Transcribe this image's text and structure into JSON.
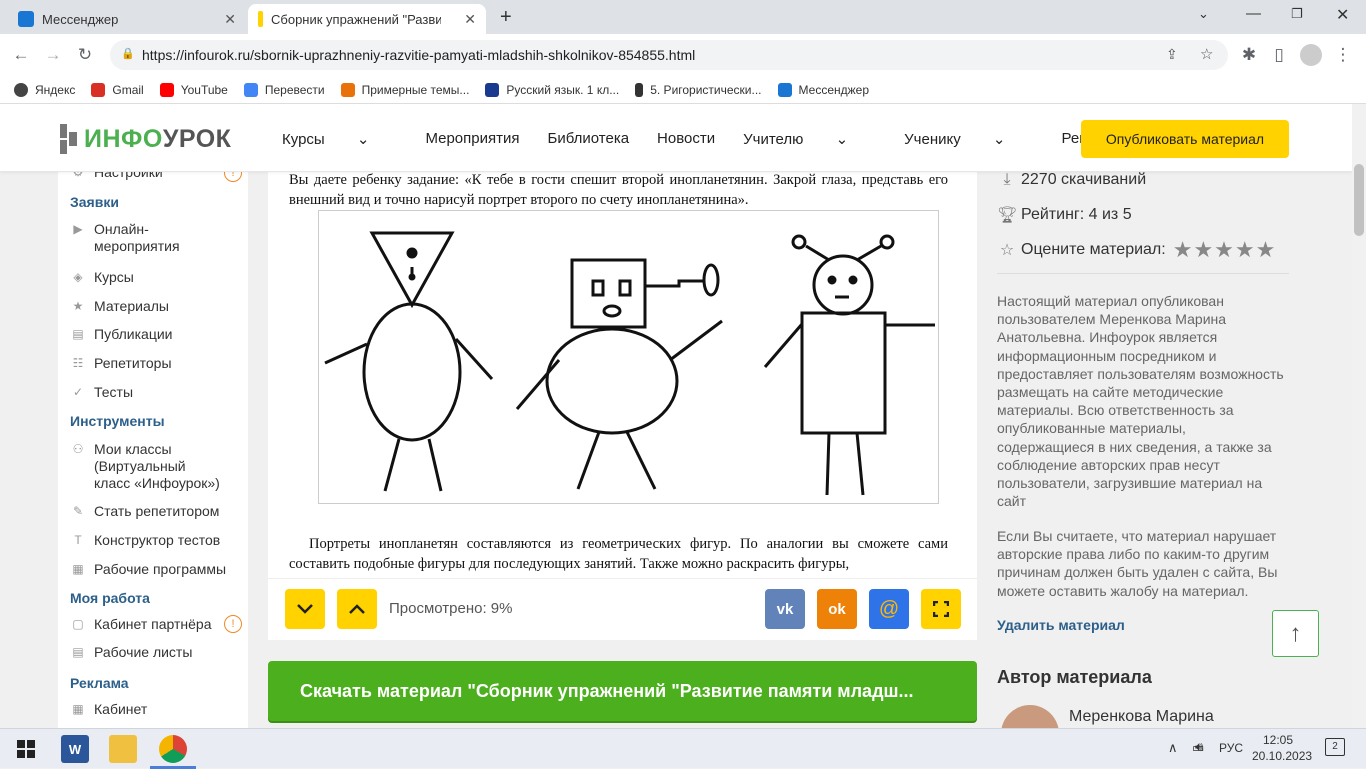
{
  "browser": {
    "tabs": [
      {
        "title": "Мессенджер",
        "active": false,
        "icon": "messenger-icon"
      },
      {
        "title": "Сборник упражнений \"Развити",
        "active": true,
        "icon": "infourok-icon"
      }
    ],
    "new_tab_symbol": "+",
    "url": "https://infourok.ru/sbornik-uprazhneniy-razvitie-pamyati-mladshih-shkolnikov-854855.html",
    "bookmarks": [
      "Яндекс",
      "Gmail",
      "YouTube",
      "Перевести",
      "Примерные темы...",
      "Русский язык. 1 кл...",
      "5. Ригористически...",
      "Мессенджер"
    ],
    "bookmark_colors": [
      "#444444",
      "#d93025",
      "#ff0000",
      "#4285f4",
      "#e8710a",
      "#1a3a8f",
      "#333333",
      "#1976d2"
    ]
  },
  "site": {
    "logo_part1": "ИНФО",
    "logo_part2": "УРОК",
    "menu": [
      "Курсы",
      "Мероприятия",
      "Библиотека",
      "Новости",
      "Учителю",
      "Ученику",
      "Репетиторы"
    ],
    "menu_has_dropdown": [
      true,
      false,
      false,
      false,
      true,
      true,
      false
    ],
    "dropdown_symbol": "⌄",
    "publish_button": "Опубликовать материал",
    "accent_green": "#4caf50",
    "accent_yellow": "#ffd200"
  },
  "sidebar": {
    "top_item": "Настройки",
    "top_item_badge": "!",
    "sections": [
      {
        "title": "Заявки",
        "items": [
          {
            "label": "Онлайн-\nмероприятия",
            "icon": "play-icon"
          },
          {
            "label": "Курсы",
            "icon": "graduation-cap-icon"
          },
          {
            "label": "Материалы",
            "icon": "star-icon"
          },
          {
            "label": "Публикации",
            "icon": "book-icon"
          },
          {
            "label": "Репетиторы",
            "icon": "users-icon"
          },
          {
            "label": "Тесты",
            "icon": "check-circle-icon"
          }
        ]
      },
      {
        "title": "Инструменты",
        "items": [
          {
            "label": "Мои классы\n(Виртуальный\nкласс «Инфоурок»)",
            "icon": "group-icon"
          },
          {
            "label": "Стать репетитором",
            "icon": "certificate-icon"
          },
          {
            "label": "Конструктор тестов",
            "icon": "text-icon"
          },
          {
            "label": "Рабочие программы",
            "icon": "calendar-icon"
          }
        ]
      },
      {
        "title": "Моя работа",
        "items": [
          {
            "label": "Кабинет партнёра",
            "icon": "document-icon",
            "badge": "!"
          },
          {
            "label": "Рабочие листы",
            "icon": "book-icon"
          }
        ]
      },
      {
        "title": "Реклама",
        "items": [
          {
            "label": "Кабинет",
            "icon": "grid-icon"
          }
        ]
      }
    ]
  },
  "article": {
    "para1": "Вы даете ребенку задание: «К тебе в гости спешит второй инопланетянин. Закрой глаза, представь его внешний вид и точно нарисуй портрет второго по счету инопланетянина».",
    "para2": "Портреты инопланетян составляются из геометрических фигур. По аналогии вы сможете сами составить подобные фигуры для последующих занятий. Также можно раскрасить фигуры,",
    "viewed": "Просмотрено: 9%",
    "share_colors": {
      "vk": "#6183b9",
      "ok": "#ee8208",
      "mail": "#2e74e8",
      "fullscreen": "#ffd200"
    },
    "share_labels": {
      "vk": "vk",
      "ok": "ok",
      "mail": "@"
    },
    "download_button": "Скачать материал \"Сборник упражнений \"Развитие памяти младш..."
  },
  "right": {
    "downloads": "2270 скачиваний",
    "rating": "Рейтинг: 4 из 5",
    "rate_label": "Оцените материал:",
    "stars": 5,
    "disclaimer": "Настоящий материал опубликован пользователем Меренкова Марина Анатольевна. Инфоурок является информационным посредником и предоставляет пользователям возможность размещать на сайте методические материалы. Всю ответственность за опубликованные материалы, содержащиеся в них сведения, а также за соблюдение авторских прав несут пользователи, загрузившие материал на сайт",
    "complaint": "Если Вы считаете, что материал нарушает авторские права либо по каким-то другим причинам должен быть удален с сайта, Вы можете оставить жалобу на материал.",
    "delete_link": "Удалить материал",
    "author_heading": "Автор материала",
    "author_name": "Меренкова Марина"
  },
  "taskbar": {
    "lang": "РУС",
    "time": "12:05",
    "date": "20.10.2023",
    "notifications": "2",
    "up_arrow": "∧",
    "word_letter": "W"
  }
}
